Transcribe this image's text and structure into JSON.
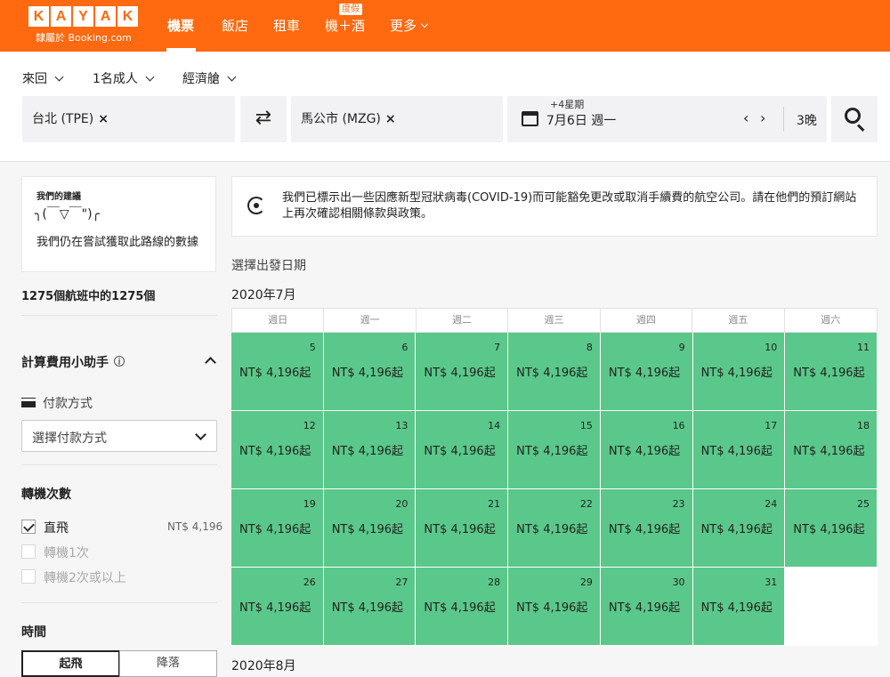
{
  "header": {
    "logo_letters": [
      "K",
      "A",
      "Y",
      "A",
      "K"
    ],
    "logo_sub": "隸屬於 Booking.com",
    "nav": [
      {
        "label": "機票",
        "active": true
      },
      {
        "label": "飯店",
        "active": false
      },
      {
        "label": "租車",
        "active": false
      },
      {
        "label": "機＋酒",
        "active": false
      },
      {
        "label": "更多",
        "active": false
      }
    ],
    "badge": "度假",
    "accent_color": "#ff690f"
  },
  "search": {
    "trip_type": "來回",
    "passengers": "1名成人",
    "cabin": "經濟艙",
    "origin": "台北 (TPE)",
    "destination": "馬公市 (MZG)",
    "remove_glyph": "×",
    "swap_glyph": "⇄",
    "date_hint": "+4星期",
    "date": "7月6日 週一",
    "prev_glyph": "‹",
    "next_glyph": "›",
    "nights": "3晚",
    "search_icon": "search-icon"
  },
  "sidebar": {
    "advice_title": "我們的建議",
    "advice_face": "╮(￣▽￣\")╭",
    "advice_message": "我們仍在嘗試獲取此路線的數據",
    "flight_count": "1275個航班中的1275個",
    "fee_helper_title": "計算費用小助手",
    "info_glyph": "i",
    "payment_label": "付款方式",
    "payment_placeholder": "選擇付款方式",
    "stops_title": "轉機次數",
    "stops": [
      {
        "label": "直飛",
        "price": "NT$ 4,196",
        "checked": true,
        "disabled": false
      },
      {
        "label": "轉機1次",
        "price": "",
        "checked": false,
        "disabled": true
      },
      {
        "label": "轉機2次或以上",
        "price": "",
        "checked": false,
        "disabled": true
      }
    ],
    "time_title": "時間",
    "time_tabs": [
      "起飛",
      "降落"
    ]
  },
  "main": {
    "notice": "我們已標示出一些因應新型冠狀病毒(COVID-19)而可能豁免更改或取消手續費的航空公司。請在他們的預訂網站上再次確認相關條款與政策。",
    "choose_date": "選擇出發日期",
    "month_label": "2020年7月",
    "next_month_label": "2020年8月",
    "weekdays": [
      "週日",
      "週一",
      "週二",
      "週三",
      "週四",
      "週五",
      "週六"
    ],
    "price_color": "#5ac88a",
    "days": [
      {
        "day": "5",
        "price": "NT$ 4,196起"
      },
      {
        "day": "6",
        "price": "NT$ 4,196起"
      },
      {
        "day": "7",
        "price": "NT$ 4,196起"
      },
      {
        "day": "8",
        "price": "NT$ 4,196起"
      },
      {
        "day": "9",
        "price": "NT$ 4,196起"
      },
      {
        "day": "10",
        "price": "NT$ 4,196起"
      },
      {
        "day": "11",
        "price": "NT$ 4,196起"
      },
      {
        "day": "12",
        "price": "NT$ 4,196起"
      },
      {
        "day": "13",
        "price": "NT$ 4,196起"
      },
      {
        "day": "14",
        "price": "NT$ 4,196起"
      },
      {
        "day": "15",
        "price": "NT$ 4,196起"
      },
      {
        "day": "16",
        "price": "NT$ 4,196起"
      },
      {
        "day": "17",
        "price": "NT$ 4,196起"
      },
      {
        "day": "18",
        "price": "NT$ 4,196起"
      },
      {
        "day": "19",
        "price": "NT$ 4,196起"
      },
      {
        "day": "20",
        "price": "NT$ 4,196起"
      },
      {
        "day": "21",
        "price": "NT$ 4,196起"
      },
      {
        "day": "22",
        "price": "NT$ 4,196起"
      },
      {
        "day": "23",
        "price": "NT$ 4,196起"
      },
      {
        "day": "24",
        "price": "NT$ 4,196起"
      },
      {
        "day": "25",
        "price": "NT$ 4,196起"
      },
      {
        "day": "26",
        "price": "NT$ 4,196起"
      },
      {
        "day": "27",
        "price": "NT$ 4,196起"
      },
      {
        "day": "28",
        "price": "NT$ 4,196起"
      },
      {
        "day": "29",
        "price": "NT$ 4,196起"
      },
      {
        "day": "30",
        "price": "NT$ 4,196起"
      },
      {
        "day": "31",
        "price": "NT$ 4,196起"
      }
    ]
  }
}
